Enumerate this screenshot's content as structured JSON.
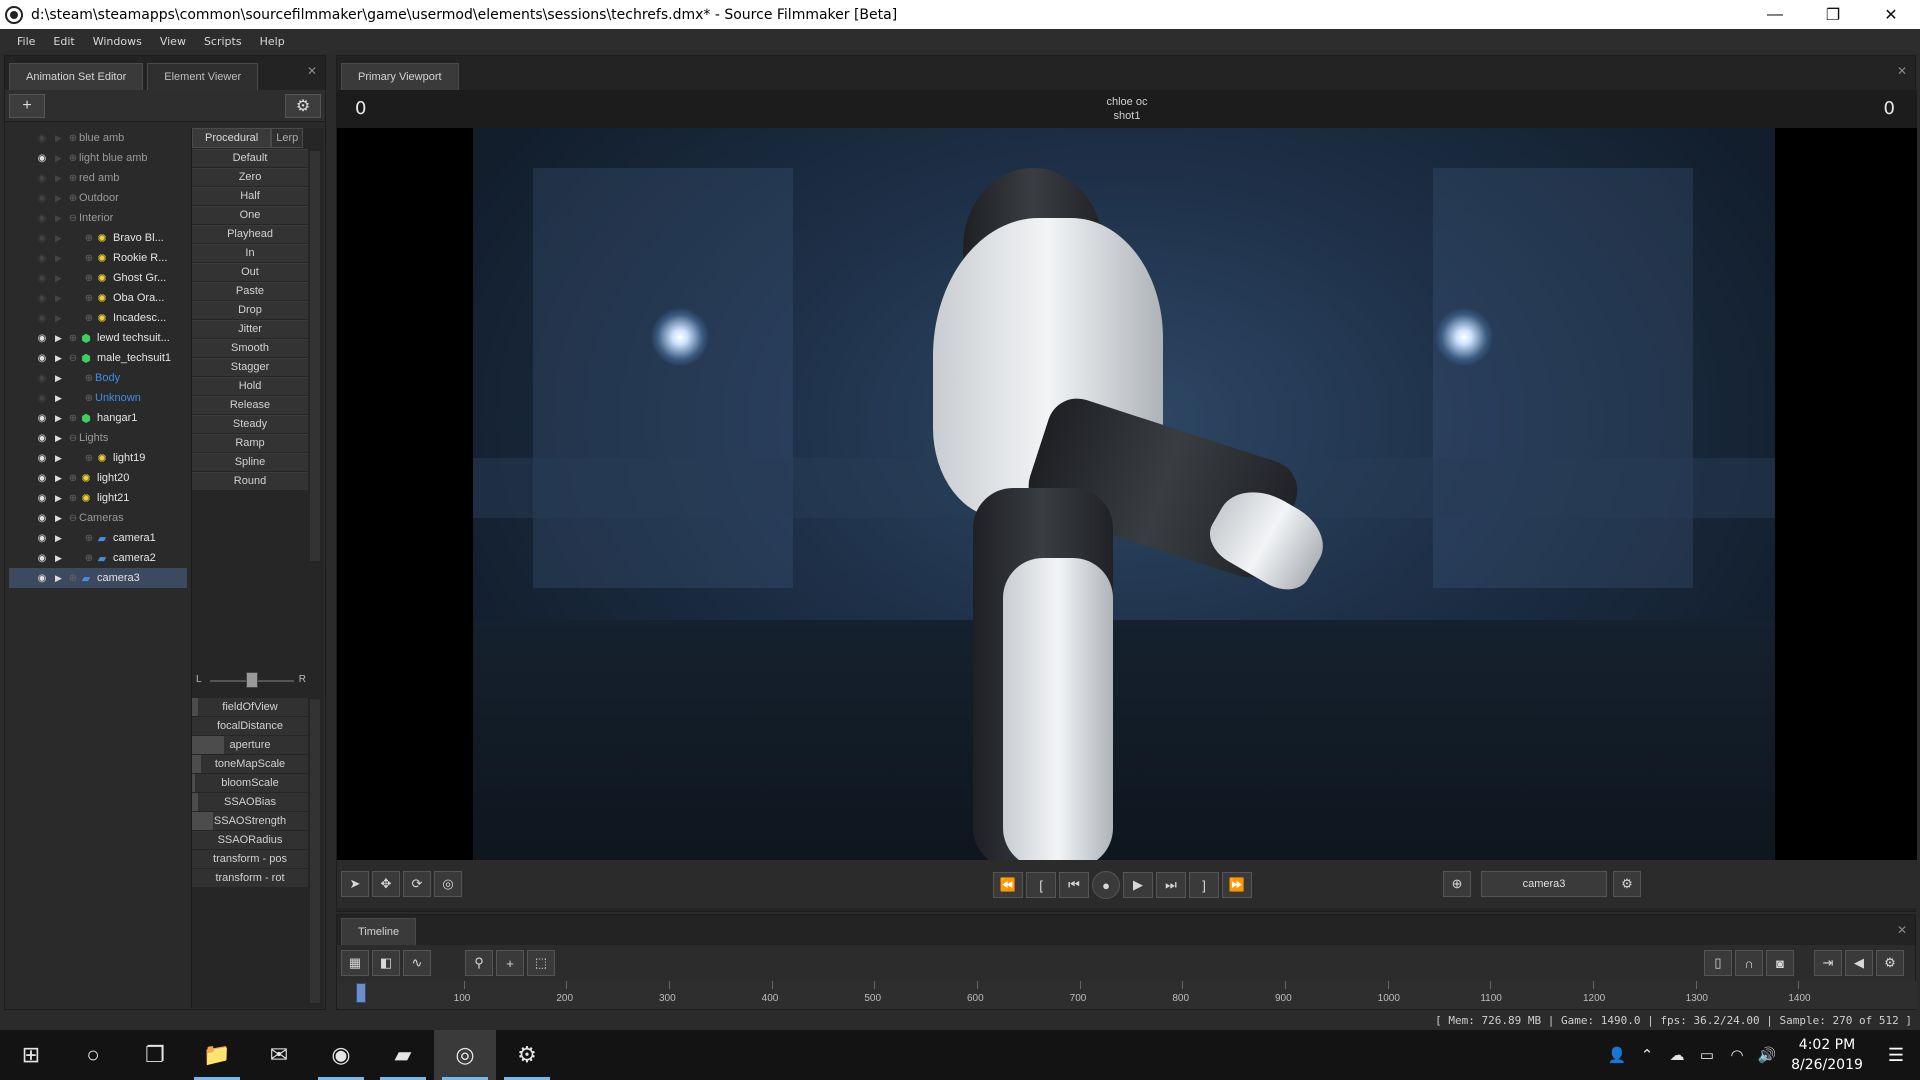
{
  "window": {
    "title": "d:\\steam\\steamapps\\common\\sourcefilmmaker\\game\\usermod\\elements\\sessions\\techrefs.dmx* - Source Filmmaker [Beta]",
    "minimize": "—",
    "maximize": "❐",
    "close": "✕"
  },
  "menu": [
    "File",
    "Edit",
    "Windows",
    "View",
    "Scripts",
    "Help"
  ],
  "left_panel": {
    "tabs": [
      "Animation Set Editor",
      "Element Viewer"
    ],
    "add_label": "+",
    "settings_label": "⚙",
    "close_label": "✕",
    "tree": [
      {
        "label": "blue amb",
        "eye": false,
        "arrow": false,
        "exp": "+",
        "icon": "",
        "indent": 0,
        "style": ""
      },
      {
        "label": "light blue amb",
        "eye": true,
        "arrow": false,
        "exp": "+",
        "icon": "",
        "indent": 0,
        "style": ""
      },
      {
        "label": "red amb",
        "eye": false,
        "arrow": false,
        "exp": "+",
        "icon": "",
        "indent": 0,
        "style": ""
      },
      {
        "label": "Outdoor",
        "eye": false,
        "arrow": false,
        "exp": "+",
        "icon": "",
        "indent": 0,
        "style": ""
      },
      {
        "label": "Interior",
        "eye": false,
        "arrow": false,
        "exp": "−",
        "icon": "",
        "indent": 0,
        "style": ""
      },
      {
        "label": "Bravo Bl...",
        "eye": false,
        "arrow": false,
        "exp": "+",
        "icon": "sun",
        "indent": 1,
        "style": "bright"
      },
      {
        "label": "Rookie R...",
        "eye": false,
        "arrow": false,
        "exp": "+",
        "icon": "sun",
        "indent": 1,
        "style": "bright"
      },
      {
        "label": "Ghost Gr...",
        "eye": false,
        "arrow": false,
        "exp": "+",
        "icon": "sun",
        "indent": 1,
        "style": "bright"
      },
      {
        "label": "Oba Ora...",
        "eye": false,
        "arrow": false,
        "exp": "+",
        "icon": "sun",
        "indent": 1,
        "style": "bright"
      },
      {
        "label": "Incadesc...",
        "eye": false,
        "arrow": false,
        "exp": "+",
        "icon": "sun",
        "indent": 1,
        "style": "bright"
      },
      {
        "label": "lewd techsuit...",
        "eye": true,
        "arrow": true,
        "exp": "+",
        "icon": "cube",
        "indent": 0,
        "style": "bright"
      },
      {
        "label": "male_techsuit1",
        "eye": true,
        "arrow": true,
        "exp": "−",
        "icon": "cube",
        "indent": 0,
        "style": "bright"
      },
      {
        "label": "Body",
        "eye": false,
        "arrow": true,
        "exp": "+",
        "icon": "",
        "indent": 1,
        "style": "blue"
      },
      {
        "label": "Unknown",
        "eye": false,
        "arrow": true,
        "exp": "+",
        "icon": "",
        "indent": 1,
        "style": "blue"
      },
      {
        "label": "hangar1",
        "eye": true,
        "arrow": true,
        "exp": "+",
        "icon": "cube",
        "indent": 0,
        "style": "bright"
      },
      {
        "label": "Lights",
        "eye": true,
        "arrow": true,
        "exp": "−",
        "icon": "",
        "indent": 0,
        "style": ""
      },
      {
        "label": "light19",
        "eye": true,
        "arrow": true,
        "exp": "+",
        "icon": "sun",
        "indent": 1,
        "style": "bright"
      },
      {
        "label": "light20",
        "eye": true,
        "arrow": true,
        "exp": "+",
        "icon": "sun",
        "indent": 0,
        "style": "bright"
      },
      {
        "label": "light21",
        "eye": true,
        "arrow": true,
        "exp": "+",
        "icon": "sun",
        "indent": 0,
        "style": "bright"
      },
      {
        "label": "Cameras",
        "eye": true,
        "arrow": true,
        "exp": "−",
        "icon": "",
        "indent": 0,
        "style": ""
      },
      {
        "label": "camera1",
        "eye": true,
        "arrow": true,
        "exp": "+",
        "icon": "cam",
        "indent": 1,
        "style": "bright"
      },
      {
        "label": "camera2",
        "eye": true,
        "arrow": true,
        "exp": "+",
        "icon": "cam",
        "indent": 1,
        "style": "bright"
      },
      {
        "label": "camera3",
        "eye": true,
        "arrow": true,
        "exp": "+",
        "icon": "cam",
        "indent": 0,
        "style": "bright sel"
      }
    ],
    "preset_tabs": [
      "Procedural",
      "Lerp"
    ],
    "presets": [
      "Default",
      "Zero",
      "Half",
      "One",
      "Playhead",
      "In",
      "Out",
      "Paste",
      "Drop",
      "Jitter",
      "Smooth",
      "Stagger",
      "Hold",
      "Release",
      "Steady",
      "Ramp",
      "Spline",
      "Round"
    ],
    "balance": {
      "left": "L",
      "right": "R",
      "value": 0.5
    },
    "attributes": [
      {
        "label": "fieldOfView",
        "level": 0.05
      },
      {
        "label": "focalDistance",
        "level": 0.0
      },
      {
        "label": "aperture",
        "level": 0.28
      },
      {
        "label": "toneMapScale",
        "level": 0.08
      },
      {
        "label": "bloomScale",
        "level": 0.03
      },
      {
        "label": "SSAOBias",
        "level": 0.05
      },
      {
        "label": "SSAOStrength",
        "level": 0.18
      },
      {
        "label": "SSAORadius",
        "level": 0.0
      },
      {
        "label": "transform - pos",
        "level": 0.0
      },
      {
        "label": "transform - rot",
        "level": 0.0
      }
    ]
  },
  "viewport": {
    "tab": "Primary Viewport",
    "close_label": "✕",
    "frame_left": "0",
    "frame_right": "0",
    "scene_name": "chloe oc",
    "shot_name": "shot1",
    "camera": "camera3",
    "tools": [
      "➤",
      "✥",
      "⟳",
      "◎"
    ],
    "transport": [
      "⏪",
      "[",
      "⏮",
      "●",
      "▶",
      "⏭",
      "]",
      "⏩"
    ],
    "target_icon": "⊕",
    "settings_icon": "⚙"
  },
  "timeline": {
    "tab": "Timeline",
    "close_label": "✕",
    "left_tools": [
      "▦",
      "◧",
      "∿",
      "⚲",
      "+",
      "⬚"
    ],
    "right_tools": [
      "▯",
      "∩",
      "◙",
      "⇥",
      "◀",
      "⚙"
    ],
    "ticks": [
      "100",
      "200",
      "300",
      "400",
      "500",
      "600",
      "700",
      "800",
      "900",
      "1000",
      "1100",
      "1200",
      "1300",
      "1400"
    ],
    "tick_range": [
      0,
      1500
    ],
    "playhead": 0
  },
  "status": "[ Mem:   726.89 MB | Game:   1490.0 | fps:   36.2/24.00 | Sample:   270 of 512 ]",
  "taskbar": {
    "apps": [
      {
        "name": "windows-start-icon",
        "glyph": "⊞",
        "state": ""
      },
      {
        "name": "search-circle-icon",
        "glyph": "○",
        "state": ""
      },
      {
        "name": "task-view-icon",
        "glyph": "❐",
        "state": ""
      },
      {
        "name": "file-explorer-icon",
        "glyph": "📁",
        "state": "active"
      },
      {
        "name": "mail-icon",
        "glyph": "✉",
        "state": ""
      },
      {
        "name": "firefox-icon",
        "glyph": "◉",
        "state": "active"
      },
      {
        "name": "sticky-notes-icon",
        "glyph": "▰",
        "state": "active"
      },
      {
        "name": "source-filmmaker-icon",
        "glyph": "◎",
        "state": "active current"
      },
      {
        "name": "steam-icon",
        "glyph": "⚙",
        "state": "active"
      }
    ],
    "tray": [
      "👤",
      "⌃",
      "☁",
      "▭",
      "◠",
      "🔊"
    ],
    "time": "4:02 PM",
    "date": "8/26/2019",
    "notification": "☰"
  },
  "colors": {
    "accent_blue": "#3c8df0",
    "sun_icon": "#f0d23a",
    "model_icon": "#39d15a",
    "camera_icon": "#4a8ce0"
  }
}
